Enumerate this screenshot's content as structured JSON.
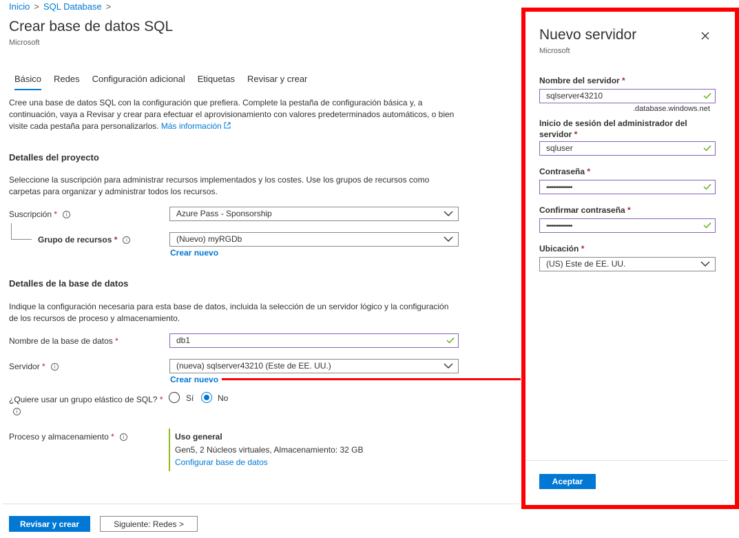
{
  "breadcrumb": {
    "items": [
      "Inicio",
      "SQL Database"
    ]
  },
  "page": {
    "title": "Crear base de datos SQL",
    "subtitle": "Microsoft"
  },
  "tabs": [
    {
      "label": "Básico",
      "active": true
    },
    {
      "label": "Redes",
      "active": false
    },
    {
      "label": "Configuración adicional",
      "active": false
    },
    {
      "label": "Etiquetas",
      "active": false
    },
    {
      "label": "Revisar y crear",
      "active": false
    }
  ],
  "intro": {
    "line1": "Cree una base de datos SQL con la configuración que prefiera. Complete la pestaña de configuración básica y, a",
    "line2": "continuación, vaya a Revisar y crear para efectuar el aprovisionamiento con valores predeterminados automáticos, o bien",
    "line3": "visite cada pestaña para personalizarlos.",
    "more_link": "Más información"
  },
  "project": {
    "heading": "Detalles del proyecto",
    "desc_line1": "Seleccione la suscripción para administrar recursos implementados y los costes. Use los grupos de recursos como",
    "desc_line2": "carpetas para organizar y administrar todos los recursos.",
    "subscription_label": "Suscripción",
    "subscription_value": "Azure Pass - Sponsorship",
    "resource_group_label": "Grupo de recursos",
    "resource_group_value": "(Nuevo) myRGDb",
    "create_new": "Crear nuevo"
  },
  "database": {
    "heading": "Detalles de la base de datos",
    "desc_line1": "Indique la configuración necesaria para esta base de datos, incluida la selección de un servidor lógico y la configuración",
    "desc_line2": "de los recursos de proceso y almacenamiento.",
    "name_label": "Nombre de la base de datos",
    "name_value": "db1",
    "server_label": "Servidor",
    "server_value": "(nueva) sqlserver43210 (Este de EE. UU.)",
    "create_new": "Crear nuevo",
    "elastic_label": "¿Quiere usar un grupo elástico de SQL?",
    "elastic_yes": "Sí",
    "elastic_no": "No",
    "compute_label": "Proceso y almacenamiento",
    "compute_title": "Uso general",
    "compute_desc": "Gen5, 2 Núcleos virtuales, Almacenamiento: 32 GB",
    "compute_link": "Configurar base de datos"
  },
  "footer": {
    "review_create": "Revisar y crear",
    "next": "Siguiente: Redes >"
  },
  "panel": {
    "title": "Nuevo servidor",
    "subtitle": "Microsoft",
    "server_name_label": "Nombre del servidor",
    "server_name_value": "sqlserver43210",
    "server_suffix": ".database.windows.net",
    "admin_label": "Inicio de sesión del administrador del servidor",
    "admin_value": "sqluser",
    "password_label": "Contraseña",
    "password_value": "•••••••••••••••",
    "confirm_label": "Confirmar contraseña",
    "confirm_value": "•••••••••••••••",
    "location_label": "Ubicación",
    "location_value": "(US) Este de EE. UU.",
    "accept": "Aceptar"
  },
  "required_marker": "*",
  "colors": {
    "accent": "#0078d4",
    "valid_border": "#8764b8",
    "valid_check": "#57a300",
    "highlight": "#ff0000"
  },
  "icons": [
    "chevron-right-icon",
    "info-icon",
    "chevron-down-icon",
    "checkmark-icon",
    "external-link-icon",
    "close-icon"
  ]
}
